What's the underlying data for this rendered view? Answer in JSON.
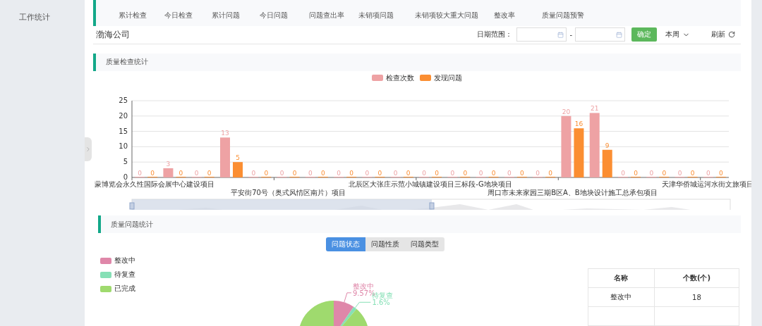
{
  "sidebar": {
    "items": [
      {
        "label": "工作统计",
        "selected": false
      }
    ]
  },
  "stats_header": {
    "labels": [
      "累计检查",
      "今日检查",
      "累计问题",
      "今日问题",
      "问题查出率",
      "未销项问题",
      "未销项较大重大问题",
      "整改率",
      "质量问题预警"
    ]
  },
  "toolbar": {
    "company": "渤海公司",
    "date_range_label": "日期范围：",
    "separator": "-",
    "confirm": "确定",
    "period": "本周",
    "refresh": "刷新"
  },
  "inspection_section": {
    "title": "质量检查统计",
    "chart_data": {
      "type": "bar",
      "categories": [
        "蒙博览会永久性国际会展中心建设项目",
        null,
        null,
        null,
        null,
        "平安街70号（奥式风情区南片）项目",
        null,
        null,
        null,
        null,
        "北辰区大张庄示范小城镇建设项目三标段-G地块项目",
        null,
        null,
        null,
        null,
        "周口市未来家园三期B区A、B地块设计施工总承包项目",
        null,
        null,
        null,
        null,
        "天津华侨城运河水街文旅项目"
      ],
      "ylim": [
        0,
        25
      ],
      "grid": true,
      "yticks": [
        0,
        5,
        10,
        15,
        20,
        25
      ],
      "data_labels": true,
      "series": [
        {
          "name": "检查次数",
          "color": "#eea2a4",
          "values": [
            0,
            3,
            0,
            13,
            0,
            0,
            0,
            0,
            0,
            0,
            0,
            0,
            0,
            0,
            0,
            20,
            21,
            0,
            0,
            0,
            0
          ]
        },
        {
          "name": "发现问题",
          "color": "#fb8e32",
          "values": [
            0,
            0,
            0,
            5,
            0,
            0,
            0,
            0,
            0,
            0,
            0,
            0,
            0,
            0,
            0,
            16,
            9,
            0,
            0,
            0,
            0
          ]
        }
      ]
    }
  },
  "issue_section": {
    "title": "质量问题统计",
    "tabs": [
      {
        "label": "问题状态",
        "selected": true
      },
      {
        "label": "问题性质",
        "selected": false
      },
      {
        "label": "问题类型",
        "selected": false
      }
    ],
    "chart_data": {
      "type": "pie",
      "categories": [
        "整改中",
        "待复查",
        "已完成"
      ],
      "values": [
        9.57,
        1.6,
        88.83
      ],
      "colors": [
        "#df87a9",
        "#86e0b6",
        "#9fda6e"
      ],
      "value_labels": [
        "9.57%",
        "1.6%",
        null
      ]
    },
    "table": {
      "columns": [
        "名称",
        "个数(个)"
      ],
      "rows": [
        [
          "整改中",
          "18"
        ]
      ]
    }
  }
}
